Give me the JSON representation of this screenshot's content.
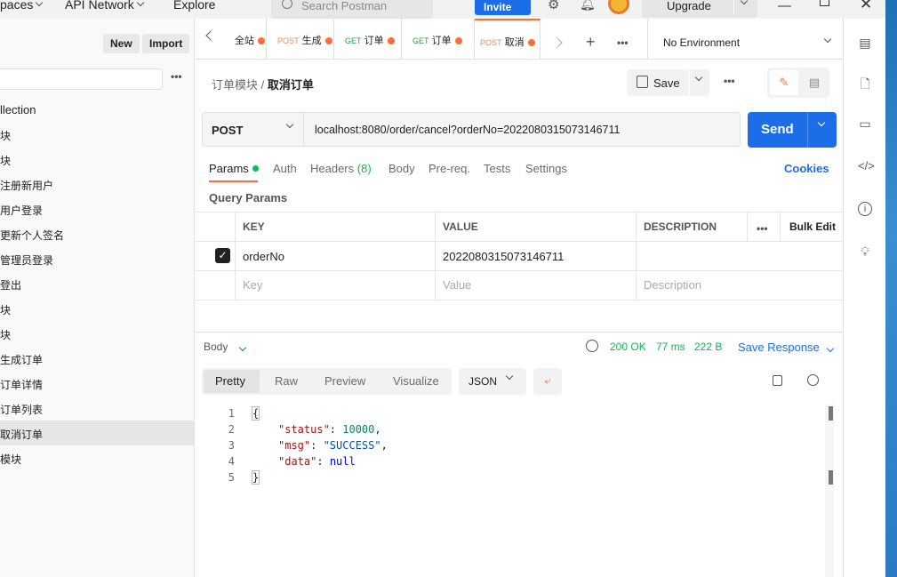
{
  "topnav": {
    "workspaces": "paces",
    "api_network": "API Network",
    "explore": "Explore",
    "search_placeholder": "Search Postman",
    "invite": "Invite",
    "upgrade": "Upgrade"
  },
  "sidebar": {
    "new_label": "New",
    "import_label": "Import",
    "items": [
      {
        "label": "llection"
      },
      {
        "label": "块"
      },
      {
        "label": "块"
      },
      {
        "label": "注册新用户"
      },
      {
        "label": "用户登录"
      },
      {
        "label": "更新个人签名"
      },
      {
        "label": "管理员登录"
      },
      {
        "label": "登出"
      },
      {
        "label": "块"
      },
      {
        "label": "块"
      },
      {
        "label": "生成订单"
      },
      {
        "label": "订单详情"
      },
      {
        "label": "订单列表"
      },
      {
        "label": "取消订单"
      },
      {
        "label": "模块"
      }
    ]
  },
  "tabs": [
    {
      "method": "",
      "label": "全站"
    },
    {
      "method": "POST",
      "label": "生成"
    },
    {
      "method": "GET",
      "label": "订单"
    },
    {
      "method": "GET",
      "label": "订单"
    },
    {
      "method": "POST",
      "label": "取消"
    }
  ],
  "environment": "No Environment",
  "breadcrumb": {
    "parent": "订单模块",
    "sep": "/",
    "current": "取消订单"
  },
  "save_label": "Save",
  "request": {
    "method": "POST",
    "url": "localhost:8080/order/cancel?orderNo=2022080315073146711",
    "send_label": "Send"
  },
  "request_tabs": {
    "params": "Params",
    "auth": "Auth",
    "headers": "Headers",
    "headers_count": "(8)",
    "body": "Body",
    "prereq": "Pre-req.",
    "tests": "Tests",
    "settings": "Settings",
    "cookies": "Cookies"
  },
  "query_params": {
    "title": "Query Params",
    "headers": {
      "key": "KEY",
      "value": "VALUE",
      "description": "DESCRIPTION",
      "bulk_edit": "Bulk Edit"
    },
    "rows": [
      {
        "checked": true,
        "key": "orderNo",
        "value": "2022080315073146711",
        "description": ""
      }
    ],
    "placeholders": {
      "key": "Key",
      "value": "Value",
      "description": "Description"
    }
  },
  "response": {
    "body_label": "Body",
    "status": "200 OK",
    "time": "77 ms",
    "size": "222 B",
    "save_response": "Save Response",
    "view_tabs": [
      "Pretty",
      "Raw",
      "Preview",
      "Visualize"
    ],
    "format": "JSON",
    "lines": [
      {
        "n": "1",
        "text": "{"
      },
      {
        "n": "2",
        "key": "\"status\"",
        "value": "10000",
        "kind": "num",
        "comma": ","
      },
      {
        "n": "3",
        "key": "\"msg\"",
        "value": "\"SUCCESS\"",
        "kind": "str",
        "comma": ","
      },
      {
        "n": "4",
        "key": "\"data\"",
        "value": "null",
        "kind": "kw",
        "comma": ""
      },
      {
        "n": "5",
        "text": "}"
      }
    ]
  },
  "colors": {
    "accent": "#ff6c37",
    "primary": "#1c6ee8",
    "status_ok": "#0cbb52"
  }
}
